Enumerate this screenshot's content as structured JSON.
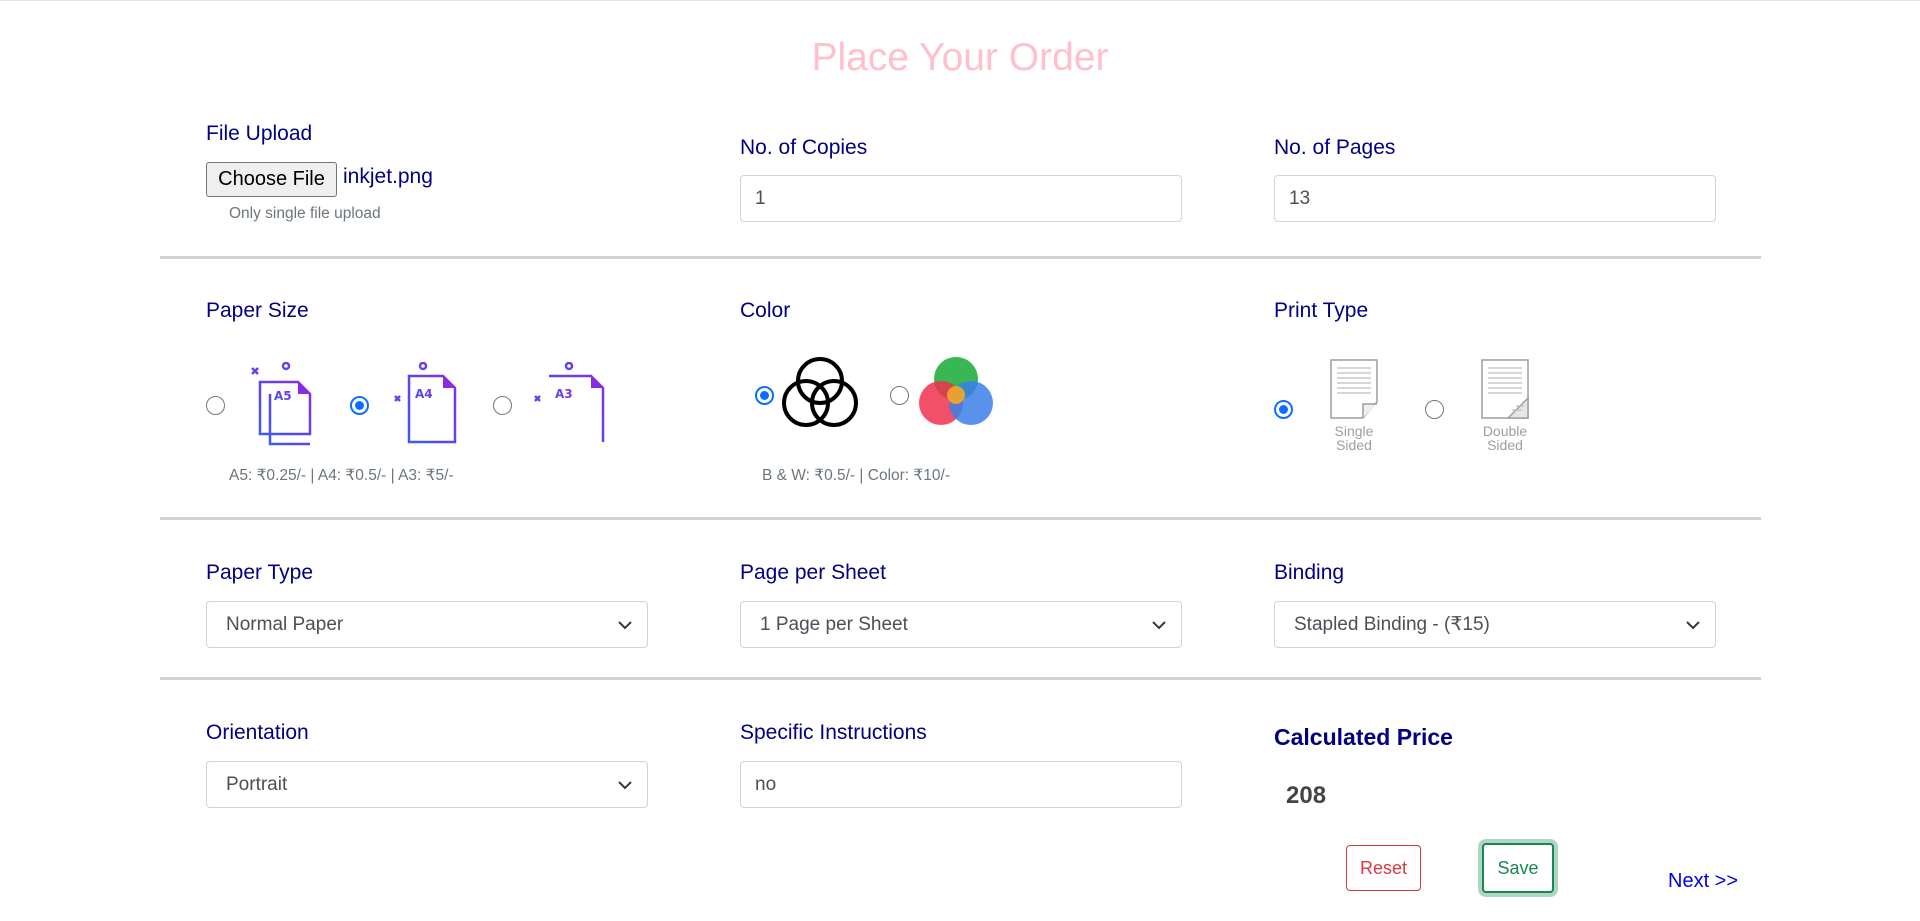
{
  "title": "Place Your Order",
  "file_upload": {
    "label": "File Upload",
    "button_label": "Choose File",
    "file_name": "inkjet.png",
    "help": "Only single file upload"
  },
  "copies": {
    "label": "No. of Copies",
    "value": "1"
  },
  "pages": {
    "label": "No. of Pages",
    "value": "13"
  },
  "paper_size": {
    "label": "Paper Size",
    "options": [
      {
        "name": "A5",
        "checked": false
      },
      {
        "name": "A4",
        "checked": true
      },
      {
        "name": "A3",
        "checked": false
      }
    ],
    "help": "A5: ₹0.25/- | A4: ₹0.5/- | A3: ₹5/-",
    "icon_colors": [
      "#3b5bf5",
      "#8a2be2"
    ]
  },
  "color": {
    "label": "Color",
    "options": [
      {
        "name": "bw",
        "checked": true
      },
      {
        "name": "color",
        "checked": false
      }
    ],
    "help": "B & W: ₹0.5/- | Color: ₹10/-"
  },
  "print_type": {
    "label": "Print Type",
    "single_label_1": "Single",
    "single_label_2": "Sided",
    "double_label_1": "Double",
    "double_label_2": "Sided",
    "single_checked": true,
    "double_checked": false
  },
  "paper_type": {
    "label": "Paper Type",
    "value": "Normal Paper"
  },
  "page_per_sheet": {
    "label": "Page per Sheet",
    "value": "1 Page per Sheet"
  },
  "binding": {
    "label": "Binding",
    "value": "Stapled Binding - (₹15)"
  },
  "orientation": {
    "label": "Orientation",
    "value": "Portrait"
  },
  "instructions": {
    "label": "Specific Instructions",
    "value": "no"
  },
  "price": {
    "title": "Calculated Price",
    "value": "208"
  },
  "actions": {
    "reset": "Reset",
    "save": "Save",
    "next": "Next >>"
  },
  "colors": {
    "label": "#000080",
    "title": "#ffc0cb",
    "reset": "#dc3545",
    "save": "#198754",
    "radio": "#0d6efd"
  }
}
